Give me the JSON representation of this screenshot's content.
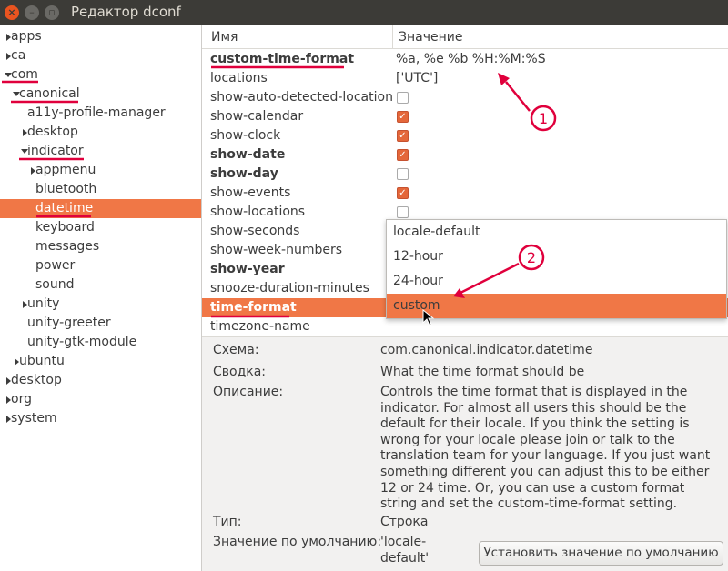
{
  "window": {
    "title": "Редактор dconf"
  },
  "tree": [
    {
      "label": "apps",
      "indent": 0,
      "tri": "right"
    },
    {
      "label": "ca",
      "indent": 0,
      "tri": "right"
    },
    {
      "label": "com",
      "indent": 0,
      "tri": "down"
    },
    {
      "label": "canonical",
      "indent": 1,
      "tri": "down"
    },
    {
      "label": "a11y-profile-manager",
      "indent": 2,
      "tri": ""
    },
    {
      "label": "desktop",
      "indent": 2,
      "tri": "right"
    },
    {
      "label": "indicator",
      "indent": 2,
      "tri": "down"
    },
    {
      "label": "appmenu",
      "indent": 3,
      "tri": "right"
    },
    {
      "label": "bluetooth",
      "indent": 3,
      "tri": ""
    },
    {
      "label": "datetime",
      "indent": 3,
      "tri": "",
      "selected": true
    },
    {
      "label": "keyboard",
      "indent": 3,
      "tri": ""
    },
    {
      "label": "messages",
      "indent": 3,
      "tri": ""
    },
    {
      "label": "power",
      "indent": 3,
      "tri": ""
    },
    {
      "label": "sound",
      "indent": 3,
      "tri": ""
    },
    {
      "label": "unity",
      "indent": 2,
      "tri": "right"
    },
    {
      "label": "unity-greeter",
      "indent": 2,
      "tri": ""
    },
    {
      "label": "unity-gtk-module",
      "indent": 2,
      "tri": ""
    },
    {
      "label": "ubuntu",
      "indent": 1,
      "tri": "right"
    },
    {
      "label": "desktop",
      "indent": 0,
      "tri": "right"
    },
    {
      "label": "org",
      "indent": 0,
      "tri": "right"
    },
    {
      "label": "system",
      "indent": 0,
      "tri": "right"
    }
  ],
  "columns": {
    "name": "Имя",
    "value": "Значение"
  },
  "keys": [
    {
      "name": "custom-time-format",
      "bold": true,
      "text": "%a, %e %b %H:%M:%S"
    },
    {
      "name": "locations",
      "text": "['UTC']"
    },
    {
      "name": "show-auto-detected-location",
      "check": false
    },
    {
      "name": "show-calendar",
      "check": true
    },
    {
      "name": "show-clock",
      "check": true
    },
    {
      "name": "show-date",
      "bold": true,
      "check": true
    },
    {
      "name": "show-day",
      "bold": true,
      "check": false
    },
    {
      "name": "show-events",
      "check": true
    },
    {
      "name": "show-locations",
      "check": false
    },
    {
      "name": "show-seconds"
    },
    {
      "name": "show-week-numbers"
    },
    {
      "name": "show-year",
      "bold": true
    },
    {
      "name": "snooze-duration-minutes"
    },
    {
      "name": "time-format",
      "bold": true,
      "selected": true
    },
    {
      "name": "timezone-name"
    }
  ],
  "dropdown": {
    "options": [
      "locale-default",
      "12-hour",
      "24-hour",
      "custom"
    ],
    "highlighted": 3
  },
  "details": {
    "schema_label": "Схема:",
    "schema_value": "com.canonical.indicator.datetime",
    "summary_label": "Сводка:",
    "summary_value": "What the time format should be",
    "description_label": "Описание:",
    "description_value": "Controls the time format that is displayed in the indicator. For almost all users this should be the default for their locale. If you think the setting is wrong for your locale please join or talk to the translation team for your language. If you just want something different you can adjust this to be either 12 or 24 time. Or, you can use a custom format string and set the custom-time-format setting.",
    "type_label": "Тип:",
    "type_value": "Строка",
    "default_label": "Значение по умолчанию:",
    "default_value_line1": "'locale-",
    "default_value_line2": "default'",
    "reset_button": "Установить значение по умолчанию"
  },
  "annotations": {
    "marker1": "1",
    "marker2": "2",
    "color": "#e0003c"
  },
  "colors": {
    "selection": "#f07746",
    "checkbox": "#e4673a",
    "titlebar": "#3c3b37"
  }
}
